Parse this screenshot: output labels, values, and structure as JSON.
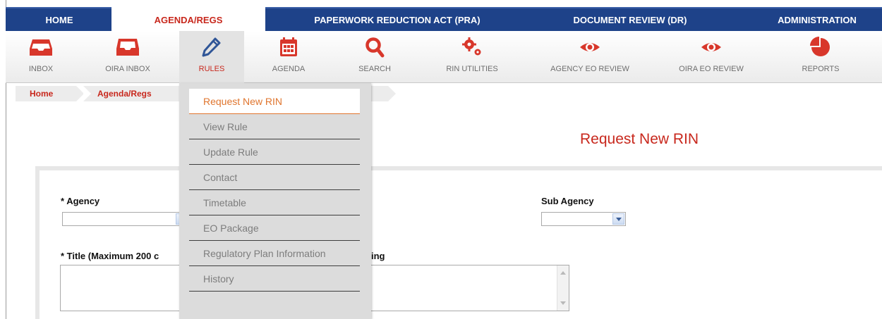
{
  "topnav": {
    "tabs": [
      {
        "label": "HOME"
      },
      {
        "label": "AGENDA/REGS"
      },
      {
        "label": "PAPERWORK REDUCTION ACT (PRA)"
      },
      {
        "label": "DOCUMENT REVIEW (DR)"
      },
      {
        "label": "ADMINISTRATION"
      }
    ]
  },
  "toolbar": {
    "items": [
      {
        "label": "INBOX",
        "icon": "inbox-icon"
      },
      {
        "label": "OIRA INBOX",
        "icon": "oira-inbox-icon"
      },
      {
        "label": "RULES",
        "icon": "pencil-icon"
      },
      {
        "label": "AGENDA",
        "icon": "calendar-icon"
      },
      {
        "label": "SEARCH",
        "icon": "search-icon"
      },
      {
        "label": "RIN UTILITIES",
        "icon": "gears-icon"
      },
      {
        "label": "AGENCY EO REVIEW",
        "icon": "eye-icon"
      },
      {
        "label": "OIRA EO REVIEW",
        "icon": "eye-icon"
      },
      {
        "label": "REPORTS",
        "icon": "pie-chart-icon"
      }
    ]
  },
  "breadcrumb": {
    "items": [
      {
        "label": "Home"
      },
      {
        "label": "Agenda/Regs"
      }
    ]
  },
  "page": {
    "title": "Request New RIN"
  },
  "form": {
    "agency_label": "* Agency",
    "sub_agency_label": "Sub Agency",
    "title_label_visible_part": "* Title (Maximum 200 c",
    "title_label_trailing_part": "ing"
  },
  "rules_menu": {
    "items": [
      {
        "label": "Request New RIN"
      },
      {
        "label": "View Rule"
      },
      {
        "label": "Update Rule"
      },
      {
        "label": "Contact"
      },
      {
        "label": "Timetable"
      },
      {
        "label": "EO Package"
      },
      {
        "label": "Regulatory Plan Information"
      },
      {
        "label": "History"
      }
    ]
  },
  "colors": {
    "nav_blue": "#1e4289",
    "accent_red": "#c8281d",
    "menu_active_orange": "#e0752e",
    "menu_bg": "#dcdcdc"
  }
}
